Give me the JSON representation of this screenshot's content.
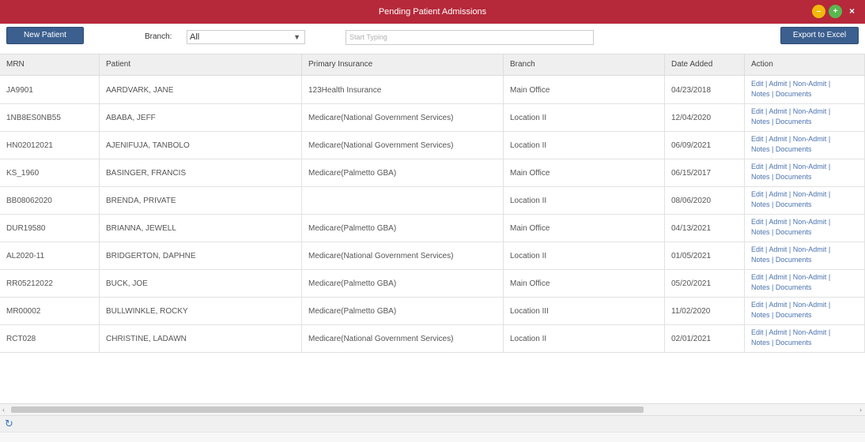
{
  "window": {
    "title": "Pending Patient Admissions",
    "controls": {
      "minimize": "–",
      "maximize": "+",
      "close": "×"
    }
  },
  "toolbar": {
    "new_patient_label": "New Patient",
    "branch_label": "Branch:",
    "branch_value": "All",
    "search_placeholder": "Start Typing",
    "export_label": "Export to Excel"
  },
  "table": {
    "columns": [
      "MRN",
      "Patient",
      "Primary Insurance",
      "Branch",
      "Date Added",
      "Action"
    ],
    "action_links": {
      "edit": "Edit",
      "admit": "Admit",
      "non_admit": "Non-Admit",
      "notes": "Notes",
      "documents": "Documents",
      "separator": "|"
    },
    "rows": [
      {
        "mrn": "JA9901",
        "patient": "AARDVARK, JANE",
        "insurance": "123Health Insurance",
        "branch": "Main Office",
        "date": "04/23/2018"
      },
      {
        "mrn": "1NB8ES0NB55",
        "patient": "ABABA, JEFF",
        "insurance": "Medicare(National Government Services)",
        "branch": "Location II",
        "date": "12/04/2020"
      },
      {
        "mrn": "HN02012021",
        "patient": "AJENIFUJA, TANBOLO",
        "insurance": "Medicare(National Government Services)",
        "branch": "Location II",
        "date": "06/09/2021"
      },
      {
        "mrn": "KS_1960",
        "patient": "BASINGER, FRANCIS",
        "insurance": "Medicare(Palmetto GBA)",
        "branch": "Main Office",
        "date": "06/15/2017"
      },
      {
        "mrn": "BB08062020",
        "patient": "BRENDA, PRIVATE",
        "insurance": "",
        "branch": "Location II",
        "date": "08/06/2020"
      },
      {
        "mrn": "DUR19580",
        "patient": "BRIANNA, JEWELL",
        "insurance": "Medicare(Palmetto GBA)",
        "branch": "Main Office",
        "date": "04/13/2021"
      },
      {
        "mrn": "AL2020-11",
        "patient": "BRIDGERTON, DAPHNE",
        "insurance": "Medicare(National Government Services)",
        "branch": "Location II",
        "date": "01/05/2021"
      },
      {
        "mrn": "RR05212022",
        "patient": "BUCK, JOE",
        "insurance": "Medicare(Palmetto GBA)",
        "branch": "Main Office",
        "date": "05/20/2021"
      },
      {
        "mrn": "MR00002",
        "patient": "BULLWINKLE, ROCKY",
        "insurance": "Medicare(Palmetto GBA)",
        "branch": "Location III",
        "date": "11/02/2020"
      },
      {
        "mrn": "RCT028",
        "patient": "CHRISTINE, LADAWN",
        "insurance": "Medicare(National Government Services)",
        "branch": "Location II",
        "date": "02/01/2021"
      }
    ]
  },
  "scrollbar": {
    "left_arrow": "‹",
    "right_arrow": "›"
  },
  "footer": {
    "refresh_icon": "↻"
  },
  "colors": {
    "titlebar": "#b5293a",
    "button": "#3b5f8f",
    "link": "#4a72b0"
  }
}
